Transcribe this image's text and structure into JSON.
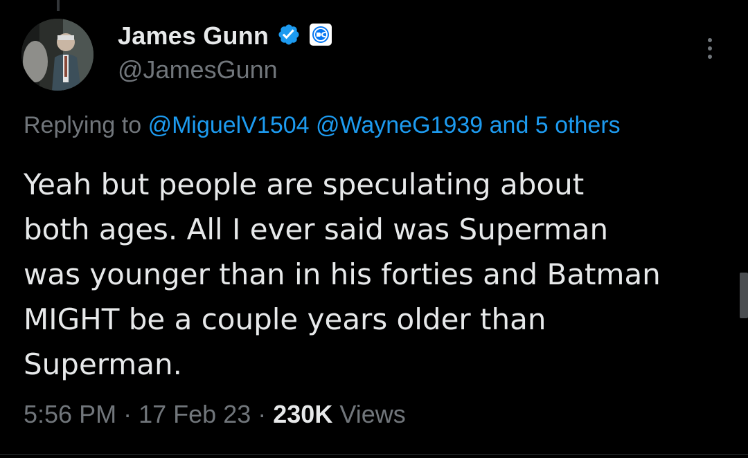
{
  "tweet": {
    "author": {
      "display_name": "James Gunn",
      "handle": "@JamesGunn",
      "verified_icon": "verified-badge-icon",
      "affiliate_icon": "dc-affiliate-icon"
    },
    "reply_to": {
      "prefix": "Replying to",
      "mentions": [
        "@MiguelV1504",
        "@WayneG1939",
        "and 5 others"
      ]
    },
    "text_lines": [
      "Yeah but people are speculating about",
      "both ages. All I ever said was Superman",
      "was younger than in his forties and Batman",
      "MIGHT be a couple years older than",
      "Superman."
    ],
    "meta": {
      "time": "5:56 PM",
      "separator": "·",
      "date": "17 Feb 23",
      "views_count": "230K",
      "views_label": "Views"
    }
  },
  "colors": {
    "background": "#000000",
    "text": "#e7e9ea",
    "muted": "#71767b",
    "link": "#1d9bf0",
    "verified": "#1d9bf0"
  }
}
